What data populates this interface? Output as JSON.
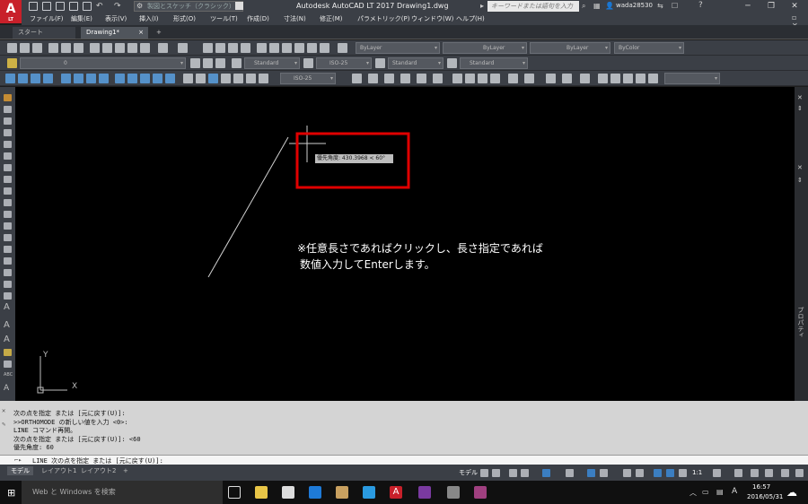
{
  "app": {
    "logo": "A",
    "logo_sub": "LT",
    "title": "Autodesk AutoCAD LT 2017    Drawing1.dwg",
    "workspace": "製図とスケッチ（クラシック）",
    "search_placeholder": "キーワードまたは語句を入力",
    "user": "wada28530"
  },
  "menu": [
    "ファイル(F)",
    "編集(E)",
    "表示(V)",
    "挿入(I)",
    "形式(O)",
    "ツール(T)",
    "作成(D)",
    "寸法(N)",
    "修正(M)",
    "パラメトリック(P)",
    "ウィンドウ(W)",
    "ヘルプ(H)"
  ],
  "tabs": {
    "start": "スタート",
    "drawing": "Drawing1*",
    "close": "×",
    "add": "+"
  },
  "toolbar": {
    "layer_value": "0",
    "color": "ByLayer",
    "linetype": "ByLayer",
    "lineweight": "ByLayer",
    "plotstyle": "ByColor",
    "textstyle": "Standard",
    "dimstyle": "ISO-25",
    "tablestyle": "Standard",
    "mleaderstyle": "Standard",
    "dimstyle2": "ISO-25"
  },
  "canvas": {
    "tooltip": "優先角度: 430.3968 < 60°",
    "annotation_line1": "※任意長さであればクリックし、長さ指定であれば",
    "annotation_line2": "数値入力してEnterします。",
    "ucs_x": "X",
    "ucs_y": "Y",
    "palette_label": "プロパティ"
  },
  "cmd_history": [
    "次の点を指定 または [元に戻す(U)]:",
    ">>ORTHOMODE の新しい値を入力 <0>:",
    "LINE コマンド再開。",
    "次の点を指定 または [元に戻す(U)]: <60",
    "優先角度: 60"
  ],
  "cmd_input": "LINE 次の点を指定 または [元に戻す(U)]:",
  "layout_tabs": [
    "モデル",
    "レイアウト1",
    "レイアウト2",
    "+"
  ],
  "status": {
    "model": "モデル",
    "scale": "1:1"
  },
  "taskbar": {
    "search": "Web と Windows を検索",
    "time": "16:57",
    "date": "2016/05/31",
    "ime": "A"
  },
  "colors": {
    "accent": "#c8202a",
    "highlight_box": "#e00000",
    "canvas": "#000000"
  }
}
